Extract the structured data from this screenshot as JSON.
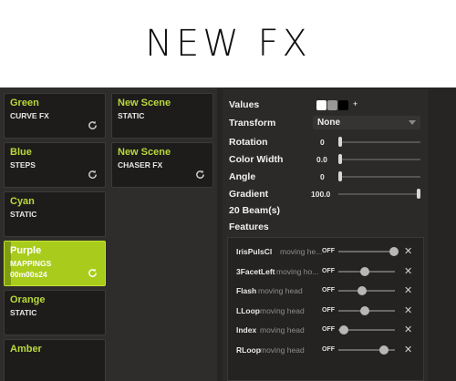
{
  "page": {
    "title": "NEW FX"
  },
  "scenes": {
    "tiles": [
      {
        "name": "Green",
        "type": "CURVE FX",
        "has_icon": true
      },
      {
        "name": "New Scene",
        "type": "STATIC",
        "has_icon": false
      },
      {
        "name": "Blue",
        "type": "STEPS",
        "has_icon": true
      },
      {
        "name": "New Scene",
        "type": "CHASER FX",
        "has_icon": true
      },
      {
        "name": "Cyan",
        "type": "STATIC",
        "has_icon": false
      },
      {
        "name": "Purple",
        "type": "MAPPINGS",
        "time": "00m00s24",
        "has_icon": true,
        "active": true,
        "progress": 0.06
      },
      {
        "name": "Orange",
        "type": "STATIC",
        "has_icon": false
      },
      {
        "name": "Amber",
        "type": "",
        "has_icon": false
      }
    ]
  },
  "properties": {
    "values_label": "Values",
    "values_swatches": [
      "#ffffff",
      "#9a9896",
      "#000000"
    ],
    "values_add": "+",
    "transform_label": "Transform",
    "transform_value": "None",
    "rotation_label": "Rotation",
    "rotation_value": "0",
    "rotation_level": 0.0,
    "color_width_label": "Color Width",
    "color_width_value": "0.0",
    "color_width_level": 0.0,
    "angle_label": "Angle",
    "angle_value": "0",
    "angle_level": 0.0,
    "gradient_label": "Gradient",
    "gradient_value": "100.0",
    "gradient_level": 1.0,
    "beams_label": "20 Beam(s)",
    "features_label": "Features"
  },
  "features": [
    {
      "name": "IrisPulsCl",
      "fixture": "moving he...",
      "state": "OFF",
      "level": 1.0
    },
    {
      "name": "3FacetLeft",
      "fixture": "moving ho...",
      "state": "OFF",
      "level": 0.43
    },
    {
      "name": "Flash",
      "fixture": "moving head",
      "state": "OFF",
      "level": 0.38
    },
    {
      "name": "LLoop",
      "fixture": "moving head",
      "state": "OFF",
      "level": 0.42
    },
    {
      "name": "Index",
      "fixture": "moving head",
      "state": "OFF",
      "level": 0.02
    },
    {
      "name": "RLoop",
      "fixture": "moving head",
      "state": "OFF",
      "level": 0.8
    }
  ],
  "colors": {
    "accent": "#a9cc1c",
    "accent_text": "#b8d83a"
  }
}
